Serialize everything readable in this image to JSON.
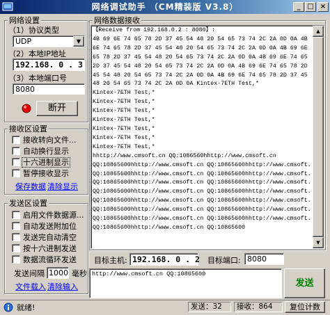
{
  "window": {
    "title": "网络调试助手 （CM精装版 V3.8）"
  },
  "net_settings": {
    "legend": "网络设置",
    "protocol_label": "（1）协议类型",
    "protocol_value": "UDP",
    "local_ip_label": "（2）本地IP地址",
    "local_ip_value": "192.168. 0 . 3",
    "local_port_label": "（3）本地端口号",
    "local_port_value": "8080",
    "toggle_label": "断开"
  },
  "recv_settings": {
    "legend": "接收区设置",
    "options": [
      {
        "label": "接收转向文件...",
        "checked": false
      },
      {
        "label": "自动换行显示",
        "checked": false
      },
      {
        "label": "十六进制显示",
        "checked": false
      },
      {
        "label": "暂停接收显示",
        "checked": false
      }
    ],
    "save_link": "保存数据",
    "clear_link": "清除显示"
  },
  "send_settings": {
    "legend": "发送区设置",
    "options": [
      {
        "label": "启用文件数据源...",
        "checked": false
      },
      {
        "label": "自动发送附加位",
        "checked": false
      },
      {
        "label": "发送完自动清空",
        "checked": false
      },
      {
        "label": "按十六进制发送",
        "checked": false
      },
      {
        "label": "数据流循环发送",
        "checked": false
      }
    ],
    "interval_label": "发送间隔",
    "interval_value": "1000",
    "interval_unit": "毫秒",
    "file_load_link": "文件载入",
    "clear_input_link": "清除输入"
  },
  "recv_area": {
    "legend": "网络数据接收",
    "lines": [
      "【Receive from 192.168.0.2 : 8080】:",
      "4B 69 6E 74 65 78 2D 37 45 54 48 20 54 65 73 74 2C 2A 0D 0A 4B 69",
      "6E 74 65 78 2D 37 45 54 48 20 54 65 73 74 2C 2A 0D 0A 4B 69 6E 74",
      "65 78 2D 37 45 54 48 20 54 65 73 74 2C 2A 0D 0A 4B 69 6E 74 65 78",
      "2D 37 45 54 48 20 54 65 73 74 2C 2A 0D 0A 4B 69 6E 74 65 78 2D 37",
      "45 54 48 20 54 65 73 74 2C 2A 0D 0A 4B 69 6E 74 65 78 2D 37 45 54",
      "48 20 54 65 73 74 2C 2A 0D 0A Kintex-7ETH Test,*",
      "Kintex-7ETH Test,*",
      "Kintex-7ETH Test,*",
      "Kintex-7ETH Test,*",
      "Kintex-7ETH Test,*",
      "Kintex-7ETH Test,*",
      "Kintex-7ETH Test,*",
      "Kintex-7ETH Test,*",
      "hhttp://www.cmsoft.cn QQ:1086560hhttp://www.cmsoft.cn",
      "QQ:10865600hhttp://www.cmsoft.cn QQ:10865600hhttp://www.cmsoft.cn",
      "QQ:10865600hhttp://www.cmsoft.cn QQ:10865600hhttp://www.cmsoft.cn",
      "QQ:10865600hhttp://www.cmsoft.cn QQ:10865600hhttp://www.cmsoft.cn",
      "QQ:10865600hhttp://www.cmsoft.cn QQ:10865600hhttp://www.cmsoft.cn",
      "QQ:10865600hhttp://www.cmsoft.cn QQ:10865600hhttp://www.cmsoft.cn",
      "QQ:10865600hhttp://www.cmsoft.cn QQ:10865600hhttp://www.cmsoft.cn",
      "QQ:10865600hhttp://www.cmsoft.cn QQ:10865600hhttp://www.cmsoft.cn",
      "QQ:10865600hhttp://www.cmsoft.cn QQ:10865600"
    ]
  },
  "target": {
    "host_label": "目标主机:",
    "host_value": "192.168. 0 . 2",
    "port_label": "目标端口:",
    "port_value": "8080"
  },
  "send_area": {
    "text": "http://www.cmsoft.cn QQ:10865600",
    "send_button": "发送"
  },
  "status_bar": {
    "ready": "就绪!",
    "sent_label": "发送：32",
    "recv_label": "接收：864",
    "reset_label": "复位计数"
  },
  "colors": {
    "title_start": "#0a246a",
    "title_end": "#a6caf0",
    "window_bg": "#d4d0c8",
    "indicator_red": "#e00000",
    "link_blue": "#0000ff"
  }
}
